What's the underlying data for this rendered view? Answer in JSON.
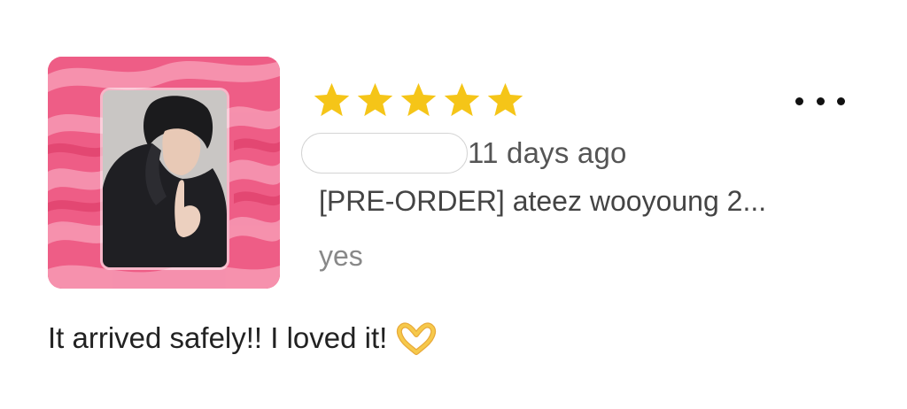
{
  "review": {
    "rating": 5,
    "max_rating": 5,
    "date": "11 days ago",
    "product_title": "[PRE-ORDER] ateez wooyoung 2...",
    "variant": "yes",
    "comment": "It arrived safely!! I loved it!",
    "comment_emoji": "heart-hands-icon"
  },
  "colors": {
    "star": "#f5c518",
    "thumb_background": "#ee5d86",
    "more_dots": "#111111"
  },
  "icons": {
    "stars": "star-icon",
    "more": "more-horizontal-icon"
  }
}
